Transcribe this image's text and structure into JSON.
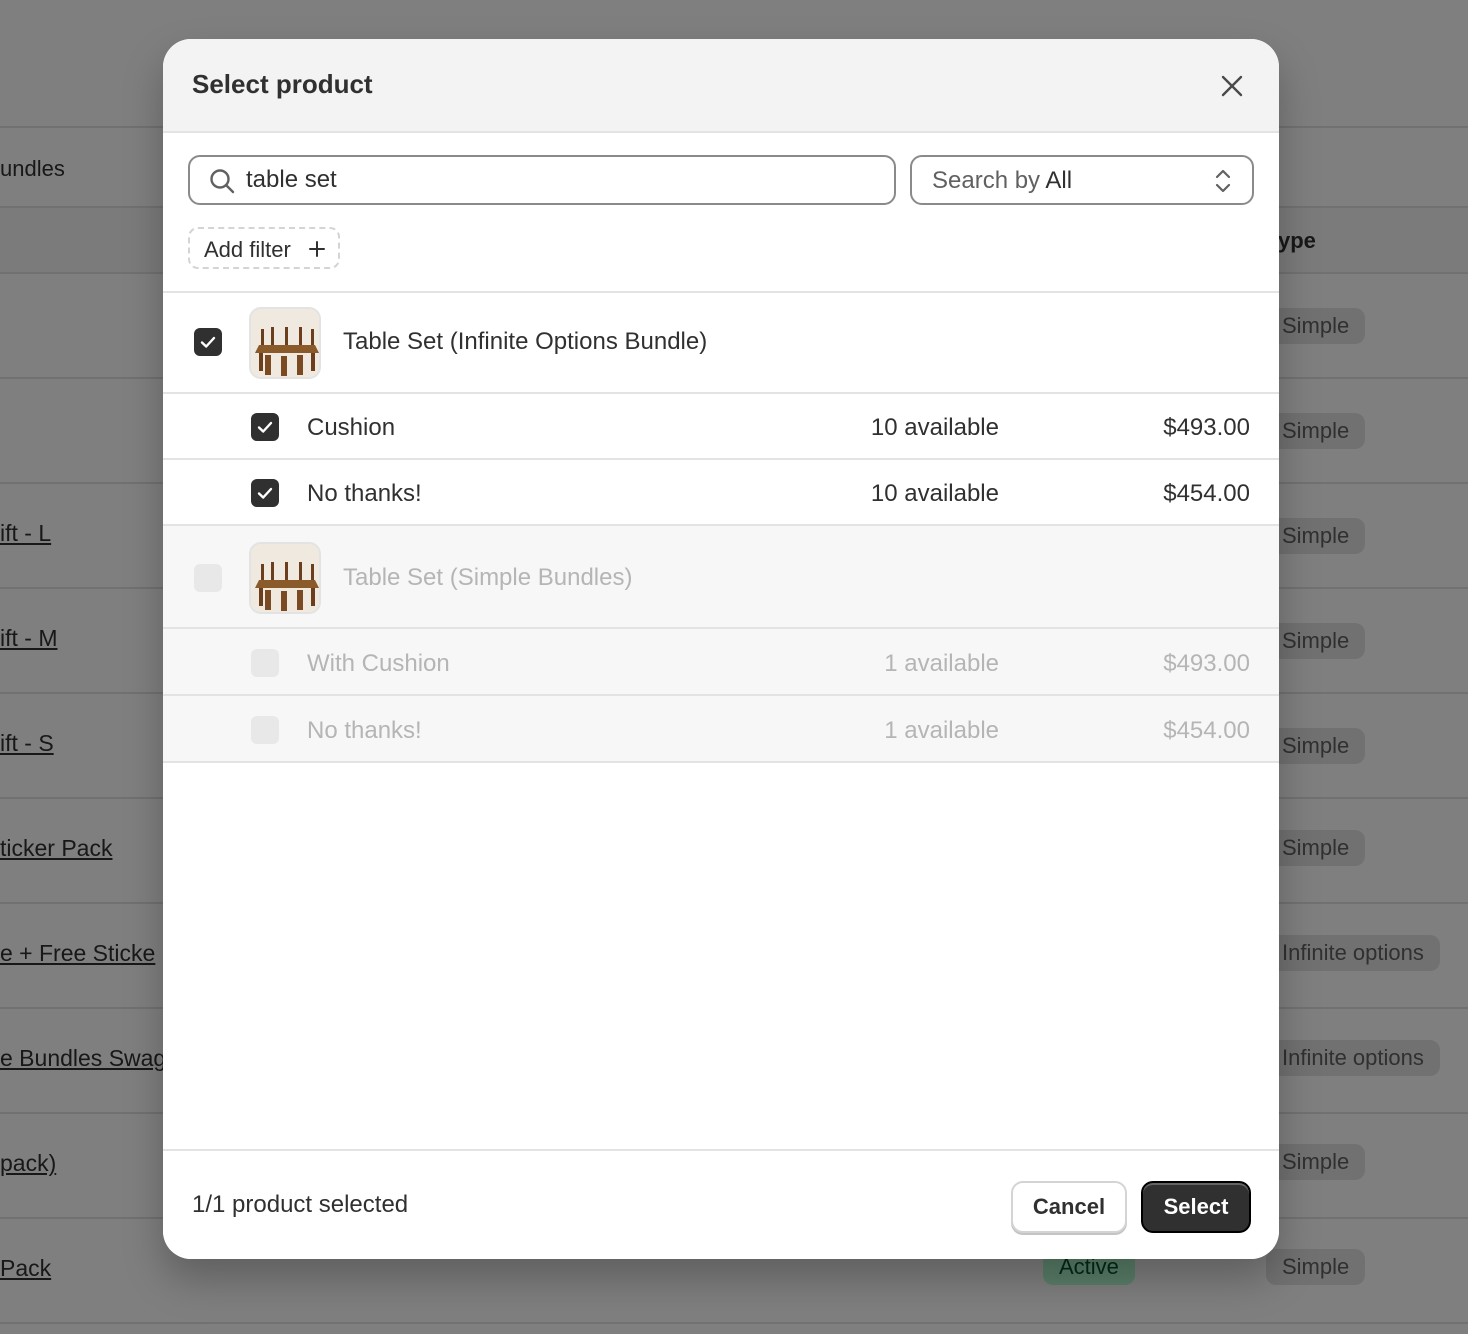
{
  "background": {
    "heading": "undles",
    "column_header": "ype",
    "rows": [
      {
        "name": "",
        "badge": "Simple",
        "status": ""
      },
      {
        "name": "",
        "badge": "Simple",
        "status": ""
      },
      {
        "name": "ift - L",
        "badge": "Simple",
        "status": ""
      },
      {
        "name": "ift - M",
        "badge": "Simple",
        "status": ""
      },
      {
        "name": "ift - S",
        "badge": "Simple",
        "status": ""
      },
      {
        "name": "ticker Pack",
        "badge": "Simple",
        "status": ""
      },
      {
        "name": "e + Free Sticke",
        "badge": "Infinite options",
        "status": ""
      },
      {
        "name": "e Bundles Swag",
        "badge": "Infinite options",
        "status": ""
      },
      {
        "name": "pack)",
        "badge": "Simple",
        "status": ""
      },
      {
        "name": "Pack",
        "badge": "Simple",
        "status": "Active"
      }
    ]
  },
  "modal": {
    "title": "Select product",
    "close_icon": "close-icon",
    "search": {
      "value": "table set",
      "icon": "search-icon"
    },
    "search_by": {
      "label": "Search by",
      "value": "All",
      "icon": "chevron-up-down-icon"
    },
    "add_filter": {
      "label": "Add filter",
      "icon": "plus-icon"
    },
    "products": [
      {
        "title": "Table Set (Infinite Options Bundle)",
        "checked": true,
        "disabled": false,
        "variants": [
          {
            "title": "Cushion",
            "available": "10 available",
            "price": "$493.00",
            "checked": true
          },
          {
            "title": "No thanks!",
            "available": "10 available",
            "price": "$454.00",
            "checked": true
          }
        ]
      },
      {
        "title": "Table Set (Simple Bundles)",
        "checked": false,
        "disabled": true,
        "variants": [
          {
            "title": "With Cushion",
            "available": "1 available",
            "price": "$493.00",
            "checked": false
          },
          {
            "title": "No thanks!",
            "available": "1 available",
            "price": "$454.00",
            "checked": false
          }
        ]
      }
    ],
    "footer": {
      "selected_count": "1/1 product selected",
      "cancel_label": "Cancel",
      "select_label": "Select"
    }
  },
  "colors": {
    "overlay": "#000000",
    "primary_button": "#303030",
    "checkbox_checked": "#303030",
    "status_active_bg": "#b4fed2"
  }
}
